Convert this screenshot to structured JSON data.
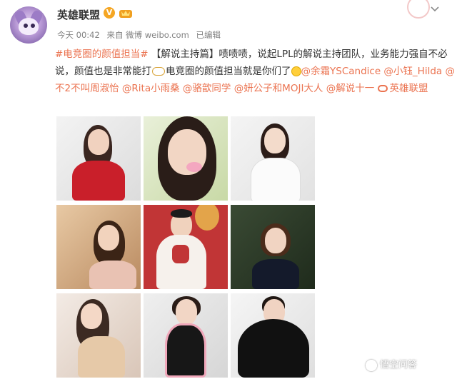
{
  "user": {
    "name": "英雄联盟"
  },
  "meta": {
    "time": "今天 00:42",
    "source": "来自 微博 weibo.com",
    "edited": "已编辑"
  },
  "post": {
    "tag1": "#电竞圈的颜值担当#",
    "topic": "【解说主持篇】",
    "text1": "啧啧啧，说起LPL的解说主持团队，业务能力强自不必说，颜值也是非常能打",
    "text2": "电竞圈的颜值担当就是你们了",
    "mentions": [
      "@余霜YSCandice",
      "@小钰_Hilda",
      "@不2不叫周淑怡",
      "@Rita小雨桑",
      "@骆歆同学",
      "@妍公子和MOJI大人",
      "@解说十一"
    ],
    "link_label": "英雄联盟"
  },
  "watermark": "悟空问答",
  "colors": {
    "accent": "#eb7350",
    "verified": "#f5a623"
  }
}
